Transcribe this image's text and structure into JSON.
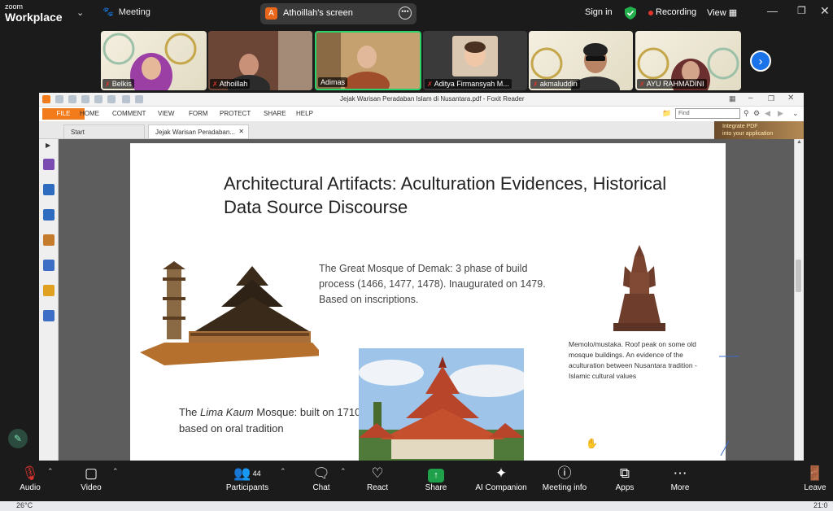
{
  "zoom": {
    "brand_small": "zoom",
    "brand_big": "Workplace",
    "meeting_label": "Meeting",
    "screen_share_avatar": "A",
    "screen_share_label": "Athoillah's screen",
    "sign_in": "Sign in",
    "recording": "Recording",
    "view": "View",
    "participants_strip": [
      {
        "name": "Belkis",
        "muted": true
      },
      {
        "name": "Athoillah",
        "muted": true
      },
      {
        "name": "Adimas",
        "muted": false,
        "active_speaker": true
      },
      {
        "name": "Aditya Firmansyah M...",
        "muted": true
      },
      {
        "name": "akmaluddin",
        "muted": true
      },
      {
        "name": "AYU RAHMADINI",
        "muted": true
      }
    ]
  },
  "foxit": {
    "window_title": "Jejak Warisan Peradaban Islam di Nusantara.pdf - Foxit Reader",
    "file_tab": "FILE",
    "menu": [
      "HOME",
      "COMMENT",
      "VIEW",
      "FORM",
      "PROTECT",
      "SHARE",
      "HELP"
    ],
    "find_placeholder": "Find",
    "tabs": [
      "Start",
      "Jejak Warisan Peradaban..."
    ],
    "ad_text": [
      "Integrate PDF",
      "into your application"
    ]
  },
  "slide": {
    "title": "Architectural Artifacts: Aculturation Evidences, Historical Data Source Discourse",
    "demak_text": "The Great Mosque of Demak: 3 phase of build process (1466, 1477, 1478). Inaugurated on 1479. Based on inscriptions.",
    "memolo_text": "Memolo/mustaka. Roof peak on some old mosque buildings. An evidence of the aculturation between Nusantara tradition - Islamic cultural values",
    "lima_prefix": "The ",
    "lima_italic": "Lima Kaum",
    "lima_suffix": " Mosque: built on 1710, based on oral tradition"
  },
  "toolbar": {
    "audio": "Audio",
    "video": "Video",
    "participants": "Participants",
    "participants_count": "44",
    "chat": "Chat",
    "react": "React",
    "share": "Share",
    "ai_companion": "AI Companion",
    "meeting_info": "Meeting info",
    "apps": "Apps",
    "more": "More",
    "leave": "Leave"
  },
  "taskbar": {
    "temperature": "26°C",
    "time": "21:0"
  },
  "colors": {
    "zoom_bg": "#1b1b1b",
    "foxit_orange": "#f27b1c",
    "recording_red": "#e0342e",
    "share_green": "#1fa04a",
    "active_speaker_border": "#2bd36b"
  }
}
